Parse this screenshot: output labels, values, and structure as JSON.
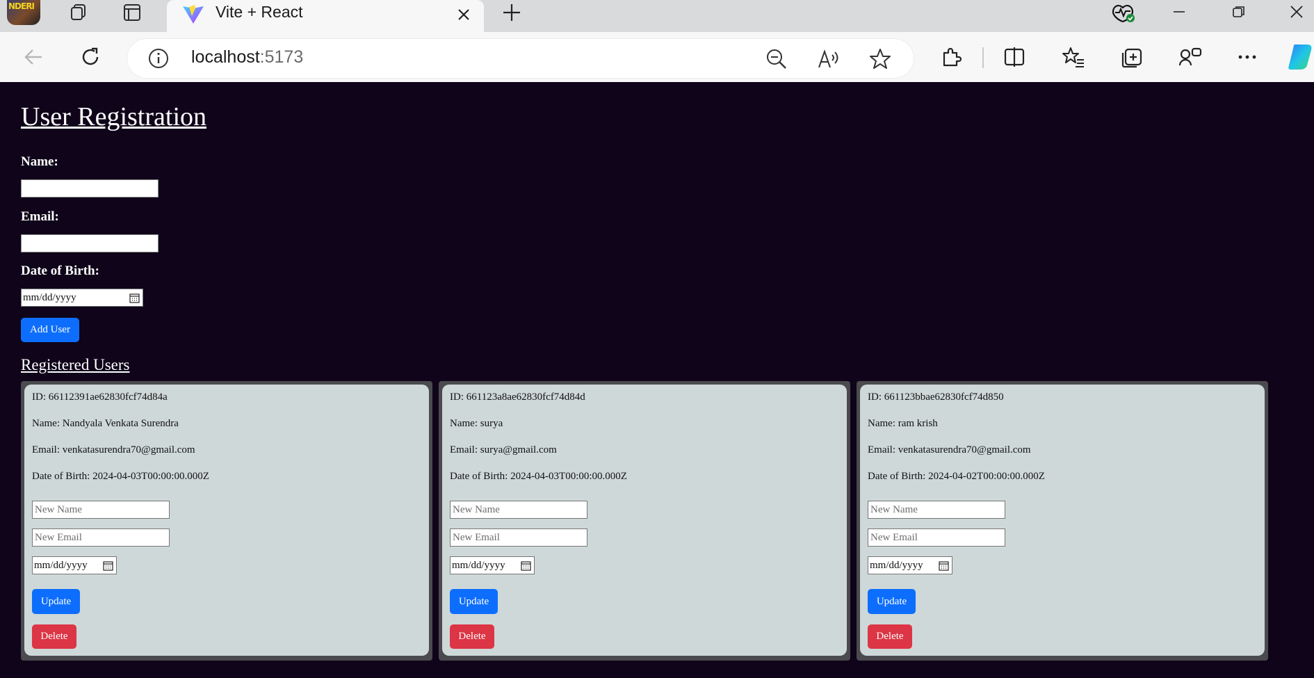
{
  "browser": {
    "tab_title": "Vite + React",
    "new_tab": "+",
    "avatar_text": "NDERI",
    "url_host": "localhost",
    "url_port": ":5173"
  },
  "page": {
    "title": "User Registration",
    "form": {
      "name_label": "Name:",
      "email_label": "Email:",
      "dob_label": "Date of Birth:",
      "date_placeholder": "mm/dd/yyyy",
      "add_button": "Add User"
    },
    "section_title": "Registered Users",
    "users": [
      {
        "id": "ID: 66112391ae62830fcf74d84a",
        "name": "Name: Nandyala Venkata Surendra",
        "email": "Email: venkatasurendra70@gmail.com",
        "dob": "Date of Birth: 2024-04-03T00:00:00.000Z"
      },
      {
        "id": "ID: 661123a8ae62830fcf74d84d",
        "name": "Name: surya",
        "email": "Email: surya@gmail.com",
        "dob": "Date of Birth: 2024-04-03T00:00:00.000Z"
      },
      {
        "id": "ID: 661123bbae62830fcf74d850",
        "name": "Name: ram krish",
        "email": "Email: venkatasurendra70@gmail.com",
        "dob": "Date of Birth: 2024-04-02T00:00:00.000Z"
      }
    ],
    "card": {
      "new_name_placeholder": "New Name",
      "new_email_placeholder": "New Email",
      "date_placeholder": "mm/dd/yyyy",
      "update_button": "Update",
      "delete_button": "Delete"
    }
  },
  "colors": {
    "page_bg": "#0f0419",
    "card_bg": "#ced8d8",
    "primary": "#0d6efd",
    "danger": "#dc3545"
  }
}
